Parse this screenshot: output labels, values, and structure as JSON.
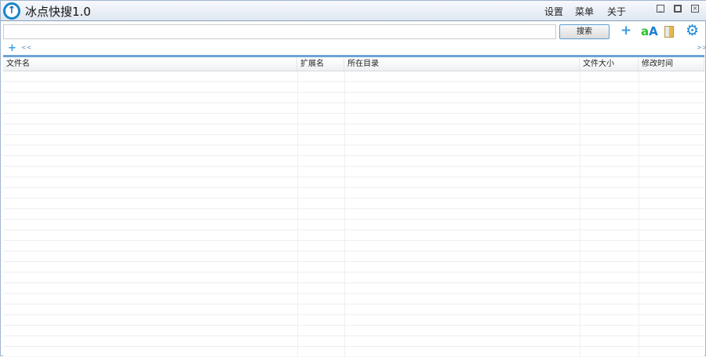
{
  "app": {
    "title": "冰点快搜1.0",
    "logo_icon": "up-arrow-circle-icon"
  },
  "menu": [
    "设置",
    "菜单",
    "关于"
  ],
  "window_buttons": [
    "minimize",
    "maximize",
    "close"
  ],
  "search": {
    "value": "",
    "placeholder": "",
    "button": "搜索"
  },
  "toolbar_icons": [
    "plus-icon",
    "font-aA-icon",
    "folder-file-icon",
    "gear-icon"
  ],
  "nav": {
    "add": "+",
    "collapse": "<<",
    "expand": ">>"
  },
  "table": {
    "columns": [
      "文件名",
      "扩展名",
      "所在目录",
      "文件大小",
      "修改时间"
    ],
    "rows": []
  },
  "colors": {
    "accent": "#1a86c8",
    "bar": "#6ea3d6"
  }
}
